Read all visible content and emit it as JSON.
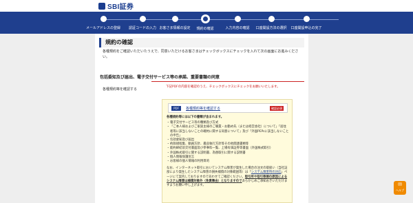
{
  "header": {
    "logo_text": "SBI証券"
  },
  "stepper": {
    "steps": [
      {
        "label": "メールアドレスの登録",
        "state": "done"
      },
      {
        "label": "認証コードの入力",
        "state": "done"
      },
      {
        "label": "お客さま情報の設定",
        "state": "done"
      },
      {
        "label": "規約の確認",
        "state": "active"
      },
      {
        "label": "入力内容の確認",
        "state": "todo"
      },
      {
        "label": "口座開設方法の選択",
        "state": "todo"
      },
      {
        "label": "口座開設申込の完了",
        "state": "todo"
      }
    ]
  },
  "page": {
    "title": "規約の確認",
    "intro": "各種規約をご確認いただいたうえで、同意いただけるお客さまはチェックボックスにチェックを入れて次の画面にお進みください。"
  },
  "section": {
    "heading": "包括委知及び届出、電子交付サービス等の承諾、重要書類の同意",
    "row_label": "各種規約等を確認する",
    "red_note": "下記PDFの内容を確認のうえ、チェックボックスにチェックをお願いいたします。"
  },
  "doc_panel": {
    "pdf_badge": "PDF",
    "link_text": "各種規約等を確認する",
    "required_badge": "確認必須",
    "lead": "各種規約等には以下の書類が含まれます。",
    "items": [
      "電子交付サービス等の種類及び方式",
      "「ご本人様およびご家族主様のご職業・お勤め先（または経営会社）について」「居住者等に該当しないことの確約に関する同意について」及び「外国PEPsに該当しないことの申告」",
      "包括委知及び届出",
      "約款規程集、動員方針、最良執行方針等その他関連書類等",
      "能約締結前交付書面及び参事料一覧、上場有価証券等書面（外国株式取引）",
      "外国株式取引に関する説明書、為替取引に関する説明書",
      "個人情報保護宣言",
      "お客様の個人情報の利用目的"
    ],
    "note_prefix": "なお、インターネット取引においてシステム障害が発生した場合の注文の取扱い（当社証部により発生したシステム障害の損失補償の対象範囲等）は「",
    "note_link": "システム障害時の対応",
    "note_middle": "」ページにて案内しておりますのであわせてご確認ください。",
    "note_strong": "取引所や取引等側の原因によるシステム障害は補償対象外（免責事由）となりますので",
    "note_suffix": "あらかじめご承知おきいただけますようお願い申し上げます。"
  },
  "help_button": {
    "label": "ヘルプ",
    "icon": "chat-icon"
  },
  "colors": {
    "brand_navy": "#1f3f8e",
    "alert_red": "#cc2222",
    "panel_yellow": "#fffbdc",
    "help_orange": "#f08a00"
  }
}
